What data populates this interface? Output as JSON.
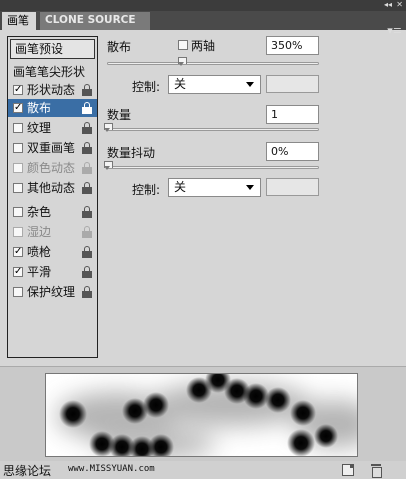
{
  "window": {
    "collapse_glyph": "◂◂",
    "close_glyph": "✕"
  },
  "tabs": [
    {
      "label": "画笔",
      "active": true
    },
    {
      "label": "CLONE SOURCE",
      "active": false
    }
  ],
  "panel_menu_glyph": "▾≡",
  "sidebar": {
    "preset_button": "画笔预设",
    "tip_shape_label": "画笔笔尖形状",
    "items": [
      {
        "label": "形状动态",
        "checked": true,
        "selected": false,
        "disabled": false
      },
      {
        "label": "散布",
        "checked": true,
        "selected": true,
        "disabled": false
      },
      {
        "label": "纹理",
        "checked": false,
        "selected": false,
        "disabled": false
      },
      {
        "label": "双重画笔",
        "checked": false,
        "selected": false,
        "disabled": false
      },
      {
        "label": "颜色动态",
        "checked": false,
        "selected": false,
        "disabled": true
      },
      {
        "label": "其他动态",
        "checked": false,
        "selected": false,
        "disabled": false
      },
      {
        "label": "杂色",
        "checked": false,
        "selected": false,
        "disabled": false
      },
      {
        "label": "湿边",
        "checked": false,
        "selected": false,
        "disabled": true
      },
      {
        "label": "喷枪",
        "checked": true,
        "selected": false,
        "disabled": false
      },
      {
        "label": "平滑",
        "checked": true,
        "selected": false,
        "disabled": false
      },
      {
        "label": "保护纹理",
        "checked": false,
        "selected": false,
        "disabled": false
      }
    ]
  },
  "scatter": {
    "label": "散布",
    "both_axes_label": "两轴",
    "both_axes_checked": false,
    "value": "350%",
    "slider_fraction": 0.35,
    "control_label": "控制:",
    "control_value": "关"
  },
  "count": {
    "label": "数量",
    "value": "1",
    "slider_fraction": 0.0
  },
  "count_jitter": {
    "label": "数量抖动",
    "value": "0%",
    "slider_fraction": 0.0,
    "control_label": "控制:",
    "control_value": "关"
  },
  "footer": {
    "watermark_cn": "思缘论坛",
    "watermark_url": "www.MISSYUAN.com"
  }
}
